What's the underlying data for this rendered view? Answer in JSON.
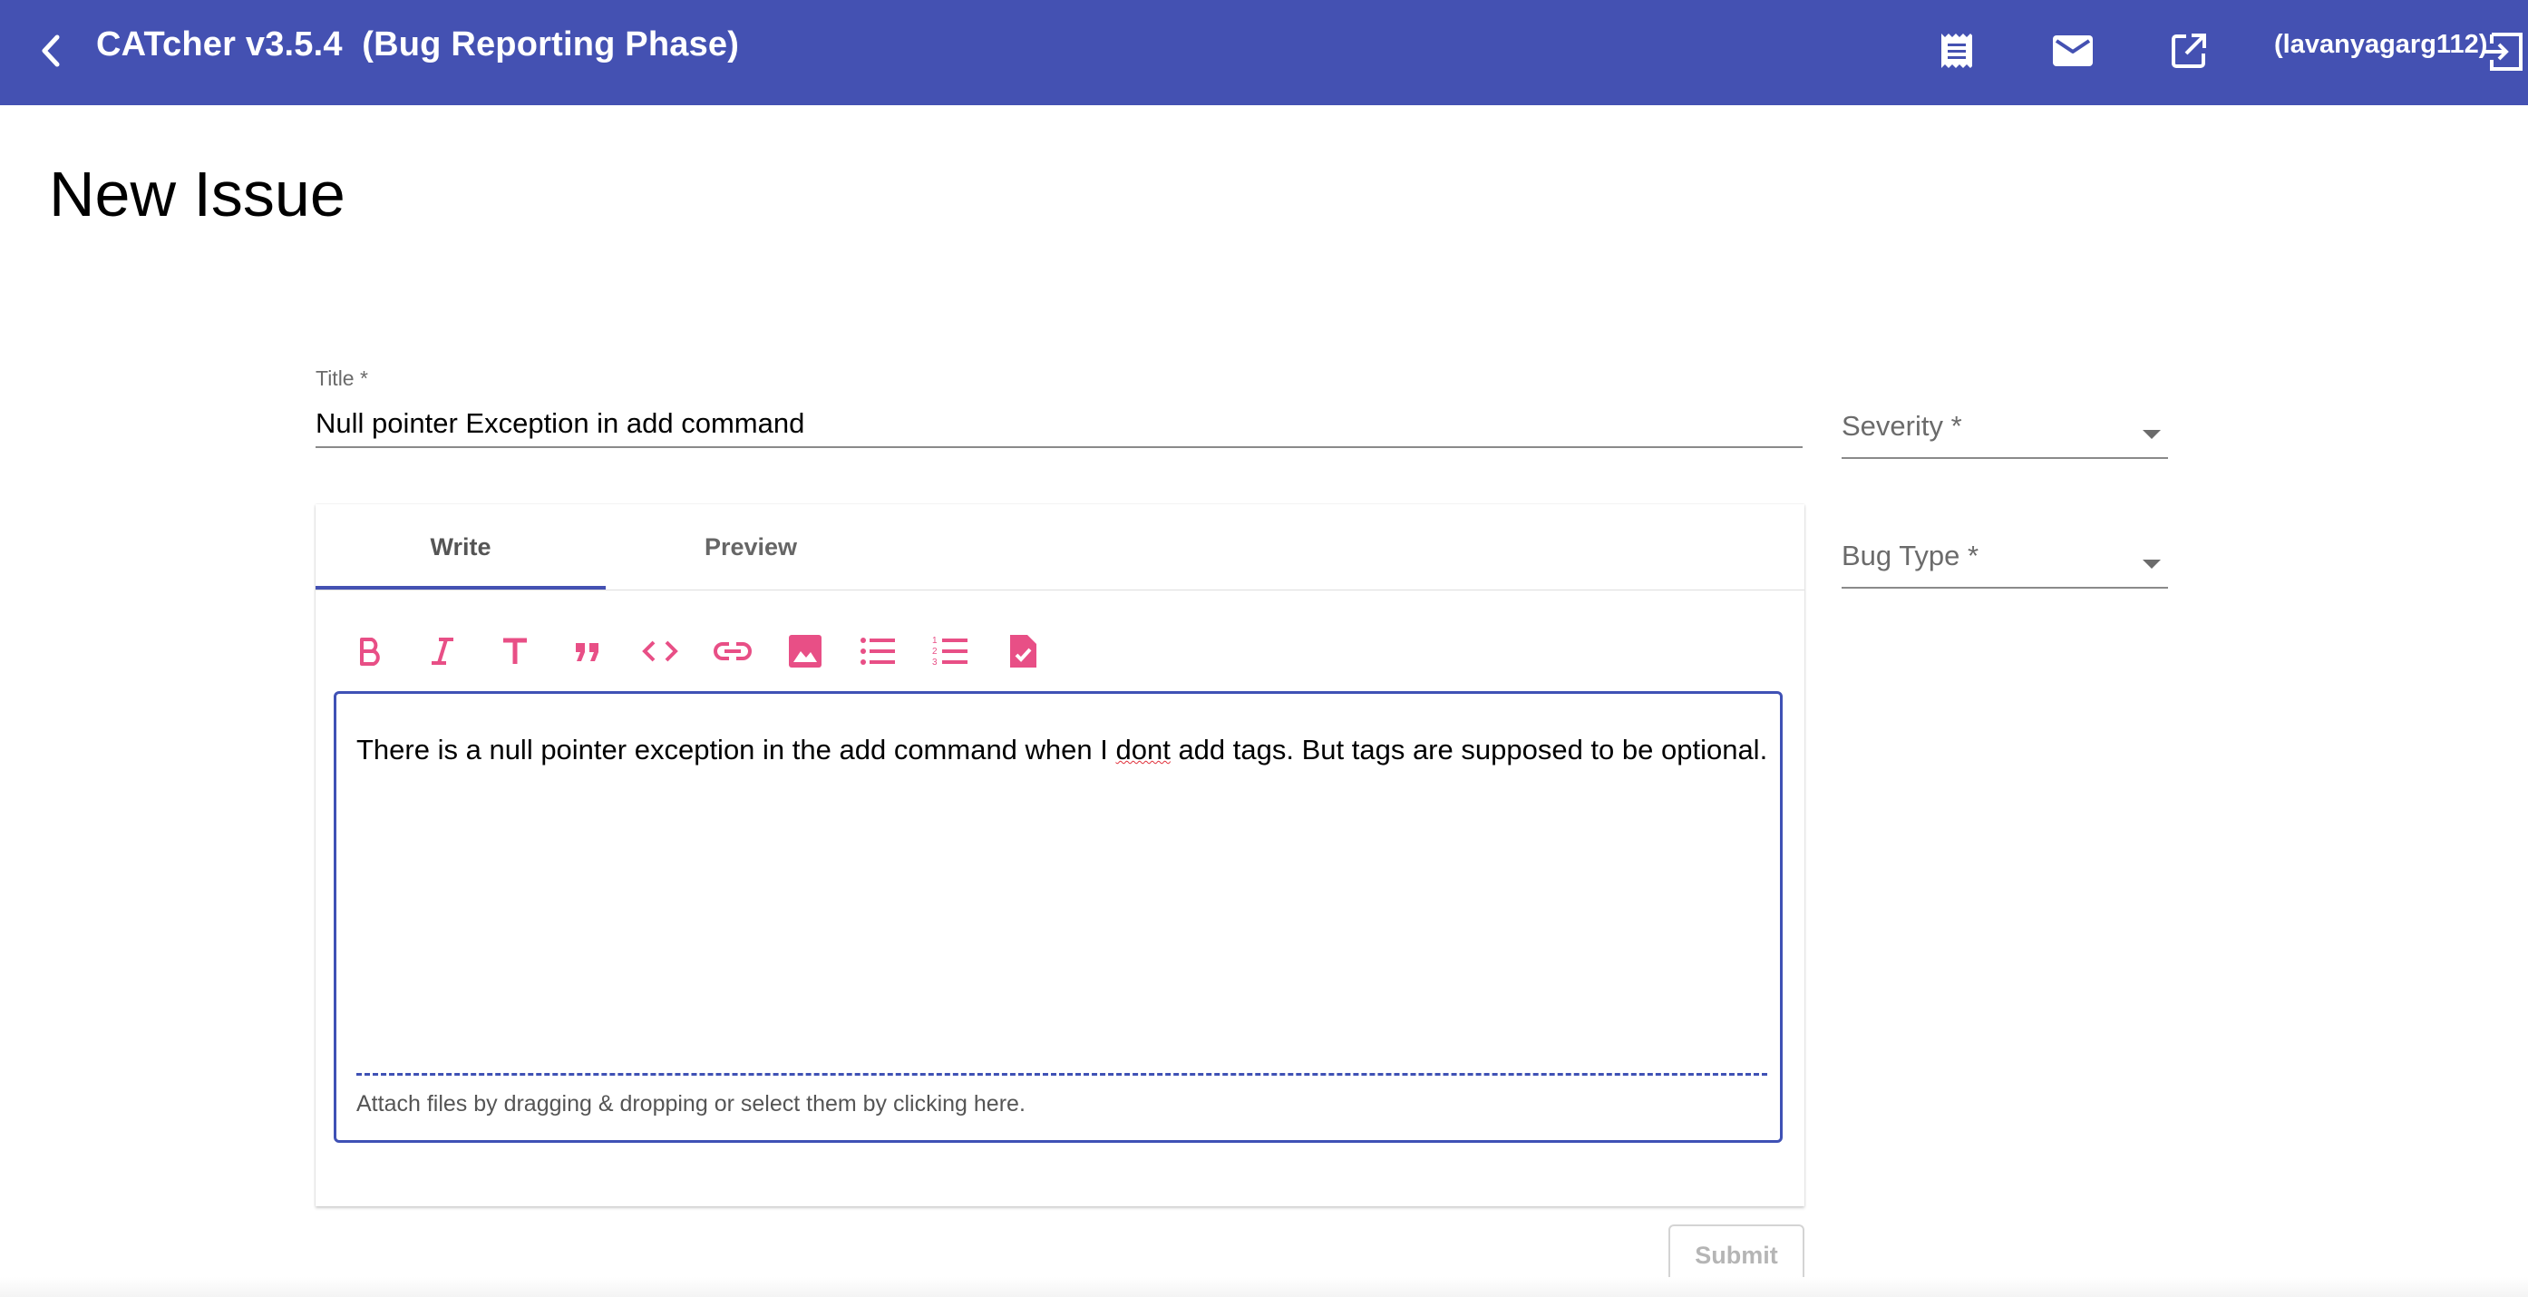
{
  "header": {
    "app_title": "CATcher v3.5.4  (Bug Reporting Phase)",
    "user": "(lavanyagarg112)",
    "background_color": "#4451b2",
    "icons": [
      "back-arrow-icon",
      "receipt-icon",
      "mail-icon",
      "open-in-new-icon",
      "logout-icon"
    ]
  },
  "page": {
    "title": "New Issue"
  },
  "form": {
    "title_label": "Title *",
    "title_value": "Null pointer Exception in add command",
    "severity_label": "Severity *",
    "bug_type_label": "Bug Type *"
  },
  "editor": {
    "tabs": [
      {
        "label": "Write",
        "active": true
      },
      {
        "label": "Preview",
        "active": false
      }
    ],
    "toolbar_icons": [
      "bold-icon",
      "italic-icon",
      "heading-icon",
      "quote-icon",
      "code-icon",
      "link-icon",
      "image-icon",
      "bulleted-list-icon",
      "numbered-list-icon",
      "task-list-icon"
    ],
    "description_before": "There is a null pointer exception in the add command when I ",
    "description_typo": "dont",
    "description_after": " add tags. But tags are supposed to be optional.",
    "attach_text": "Attach files by dragging & dropping or select them by clicking here.",
    "accent_color": "#e91e63",
    "border_color": "#3f51b5"
  },
  "actions": {
    "submit_label": "Submit"
  }
}
